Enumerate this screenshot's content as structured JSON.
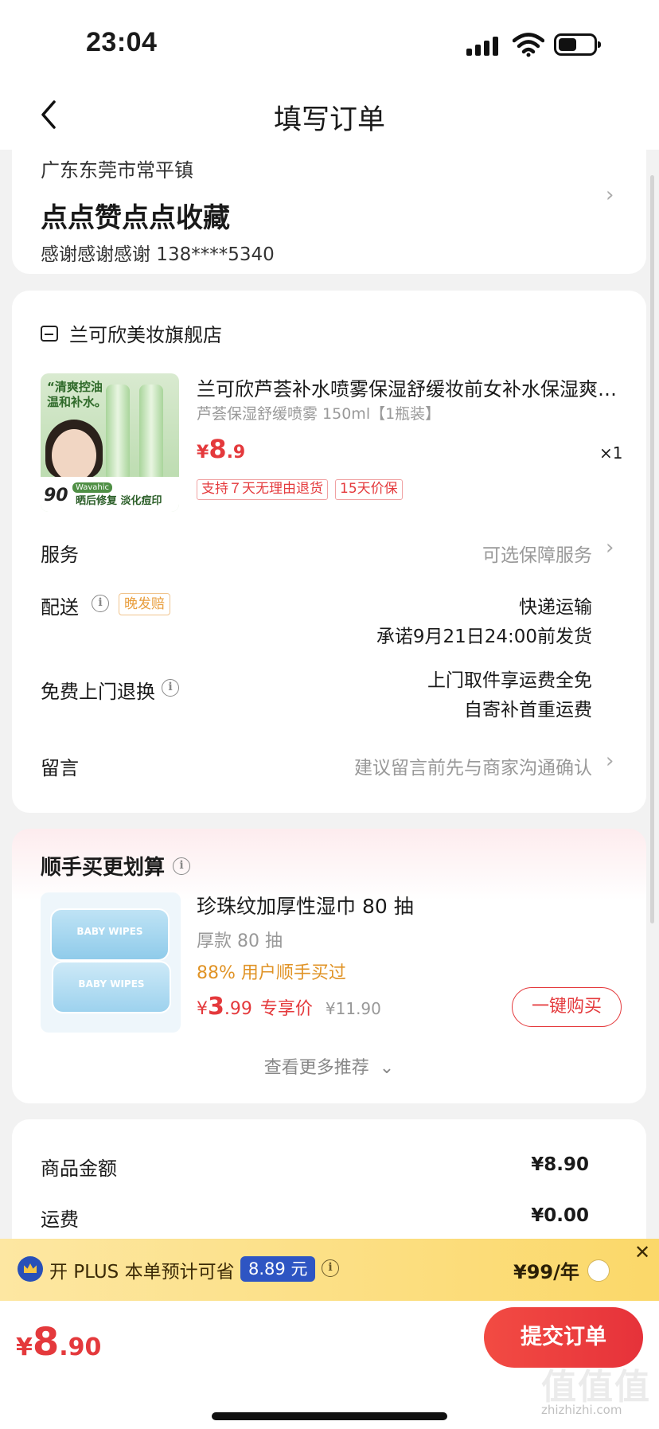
{
  "status_bar": {
    "time": "23:04"
  },
  "nav": {
    "title": "填写订单"
  },
  "address": {
    "region": "广东东莞市常平镇",
    "name": "点点赞点点收藏",
    "contact": "感谢感谢感谢  138****5340"
  },
  "store": {
    "name": "兰可欣美妆旗舰店"
  },
  "product": {
    "name": "兰可欣芦荟补水喷雾保湿舒缓妆前女补水保湿爽肤水化妆水",
    "spec": "芦荟保湿舒缓喷雾 150ml【1瓶装】",
    "price_currency": "¥",
    "price_int": "8",
    "price_dec": ".9",
    "quantity": "×1",
    "tags": [
      "支持７天无理由退货",
      "15天价保"
    ],
    "image_text": {
      "headline1": "“清爽控油",
      "headline2": "温和补水。",
      "brand": "Wavahic",
      "trial": "90",
      "bottom": "晒后修复 淡化痘印"
    }
  },
  "rows": {
    "service_label": "服务",
    "service_value": "可选保障服务",
    "delivery_label": "配送",
    "late_badge": "晚发赔",
    "delivery_method": "快递运输",
    "delivery_promise": "承诺9月21日24:00前发货",
    "return_label": "免费上门退换",
    "return_line1": "上门取件享运费全免",
    "return_line2": "自寄补首重运费",
    "note_label": "留言",
    "note_placeholder": "建议留言前先与商家沟通确认"
  },
  "upsell": {
    "title": "顺手买更划算",
    "name": "珍珠纹加厚性湿巾 80 抽",
    "spec": "厚款 80 抽",
    "percent": "88% 用户顺手买过",
    "price_currency": "¥",
    "price_int": "3",
    "price_dec": ".99",
    "exclusive": "专享价",
    "original_price": "¥11.90",
    "buy_button": "一键购买",
    "more": "查看更多推荐",
    "image_text": "BABY WIPES"
  },
  "summary": {
    "goods_label": "商品金额",
    "goods_value": "¥8.90",
    "shipping_label": "运费",
    "shipping_value": "¥0.00"
  },
  "plus": {
    "text": "开 PLUS 本单预计可省",
    "save": "8.89 元",
    "price": "¥99/年"
  },
  "footer": {
    "total_currency": "¥",
    "total_int": "8",
    "total_dec": ".90",
    "submit": "提交订单"
  },
  "watermark": {
    "text": "值值值",
    "url": "zhizhizhi.com"
  },
  "colors": {
    "accent": "#e4393c",
    "plus_blue": "#2e55c3",
    "plus_bar": "#fbd869",
    "orange": "#e09326"
  }
}
